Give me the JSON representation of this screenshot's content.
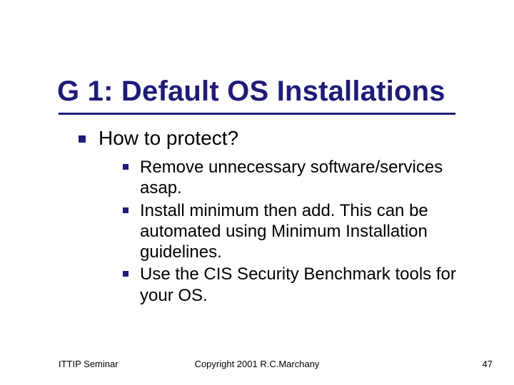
{
  "title": "G 1: Default OS Installations",
  "heading": "How to protect?",
  "bullets": [
    "Remove unnecessary software/services asap.",
    "Install minimum then add. This can be automated using Minimum Installation guidelines.",
    "Use the CIS Security Benchmark tools for your OS."
  ],
  "footer": {
    "left": "ITTIP Seminar",
    "center": "Copyright 2001 R.C.Marchany",
    "right": "47"
  }
}
